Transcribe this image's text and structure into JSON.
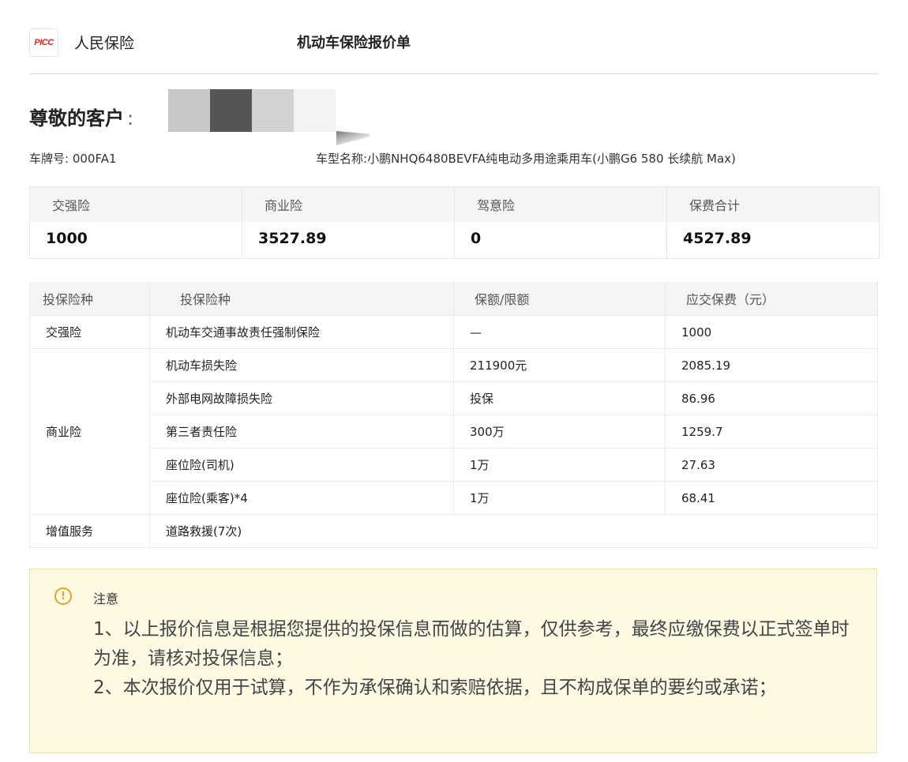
{
  "header": {
    "logo_text": "PICC",
    "company": "人民保险",
    "title": "机动车保险报价单"
  },
  "greeting": "尊敬的客户",
  "greeting_colon": ":",
  "vehicle": {
    "plate_label": "车牌号:",
    "plate_value": "000FA1",
    "model_label": "车型名称:",
    "model_value": "小鹏NHQ6480BEVFA纯电动多用途乘用车(小鹏G6 580 长续航 Max)"
  },
  "summary": [
    {
      "label": "交强险",
      "value": "1000"
    },
    {
      "label": "商业险",
      "value": "3527.89"
    },
    {
      "label": "驾意险",
      "value": "0"
    },
    {
      "label": "保费合计",
      "value": "4527.89"
    }
  ],
  "table": {
    "headers": [
      "投保险种",
      "投保险种",
      "保额/限额",
      "应交保费（元）"
    ],
    "rows": [
      {
        "type": "交强险",
        "item": "机动车交通事故责任强制保险",
        "coverage": "—",
        "premium": "1000"
      },
      {
        "type": "商业险",
        "item": "机动车损失险",
        "coverage": "211900元",
        "premium": "2085.19"
      },
      {
        "item": "外部电网故障损失险",
        "coverage": "投保",
        "premium": "86.96"
      },
      {
        "item": "第三者责任险",
        "coverage": "300万",
        "premium": "1259.7"
      },
      {
        "item": "座位险(司机)",
        "coverage": "1万",
        "premium": "27.63"
      },
      {
        "item": "座位险(乘客)*4",
        "coverage": "1万",
        "premium": "68.41"
      },
      {
        "type": "增值服务",
        "item": "道路救援(7次)"
      }
    ]
  },
  "notice": {
    "icon": "exclamation-circle-icon",
    "title": "注意",
    "line1": "1、以上报价信息是根据您提供的投保信息而做的估算，仅供参考，最终应缴保费以正式签单时为准，请核对投保信息；",
    "line2": "2、本次报价仅用于试算，不作为承保确认和索赔依据，且不构成保单的要约或承诺；"
  },
  "colors": {
    "brand_red": "#e0231b",
    "notice_bg": "#fdf9e3",
    "notice_icon": "#e3a521"
  }
}
